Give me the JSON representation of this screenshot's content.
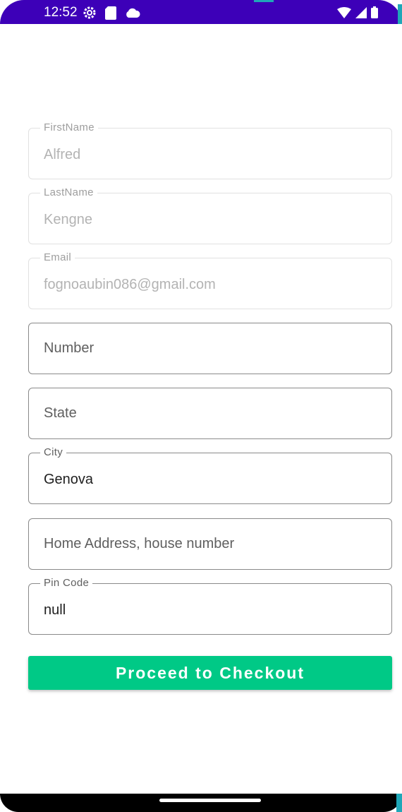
{
  "status_bar": {
    "time": "12:52",
    "left_icons": [
      "settings-icon",
      "sd-card-icon",
      "cloud-icon"
    ],
    "right_icons": [
      "wifi-icon",
      "signal-icon",
      "battery-icon"
    ],
    "background_color": "#3d00b8"
  },
  "form": {
    "fields": [
      {
        "label": "FirstName",
        "value": "Alfred",
        "state": "disabled"
      },
      {
        "label": "LastName",
        "value": "Kengne",
        "state": "disabled"
      },
      {
        "label": "Email",
        "value": "fognoaubin086@gmail.com",
        "state": "disabled"
      },
      {
        "placeholder": "Number",
        "value": "",
        "state": "empty"
      },
      {
        "placeholder": "State",
        "value": "",
        "state": "empty"
      },
      {
        "label": "City",
        "value": "Genova",
        "state": "filled"
      },
      {
        "placeholder": "Home Address, house number",
        "value": "",
        "state": "empty"
      },
      {
        "label": "Pin Code",
        "value": "null",
        "state": "filled"
      }
    ]
  },
  "checkout_button": {
    "label": "Proceed to Checkout",
    "color": "#00c986"
  }
}
